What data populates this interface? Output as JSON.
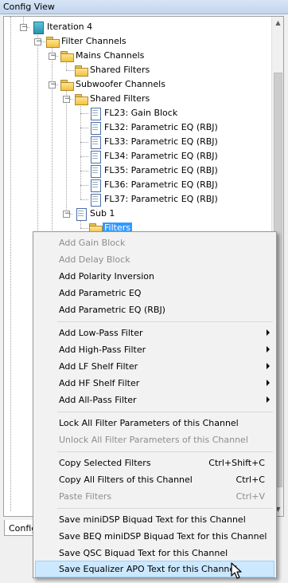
{
  "window": {
    "title": "Config View"
  },
  "tree": {
    "iteration": "Iteration 4",
    "filter_channels": "Filter Channels",
    "mains_channels": "Mains Channels",
    "mains_shared_filters": "Shared Filters",
    "subwoofer_channels": "Subwoofer Channels",
    "sub_shared_filters": "Shared Filters",
    "filters": [
      "FL23: Gain Block",
      "FL32: Parametric EQ (RBJ)",
      "FL33: Parametric EQ (RBJ)",
      "FL34: Parametric EQ (RBJ)",
      "FL35: Parametric EQ (RBJ)",
      "FL36: Parametric EQ (RBJ)",
      "FL37: Parametric EQ (RBJ)"
    ],
    "sub1": "Sub 1",
    "sub1_filters": "Filters"
  },
  "tab": {
    "label": "Config"
  },
  "menu": {
    "add_gain_block": "Add Gain Block",
    "add_delay_block": "Add Delay Block",
    "add_polarity_inversion": "Add Polarity Inversion",
    "add_parametric_eq": "Add Parametric EQ",
    "add_parametric_eq_rbj": "Add Parametric EQ (RBJ)",
    "add_low_pass": "Add Low-Pass Filter",
    "add_high_pass": "Add High-Pass Filter",
    "add_lf_shelf": "Add LF Shelf Filter",
    "add_hf_shelf": "Add HF Shelf Filter",
    "add_all_pass": "Add All-Pass Filter",
    "lock_all": "Lock All Filter Parameters of this Channel",
    "unlock_all": "Unlock All Filter Parameters of this Channel",
    "copy_selected": "Copy Selected Filters",
    "copy_selected_shortcut": "Ctrl+Shift+C",
    "copy_all": "Copy All Filters of this Channel",
    "copy_all_shortcut": "Ctrl+C",
    "paste": "Paste Filters",
    "paste_shortcut": "Ctrl+V",
    "save_minidsp": "Save miniDSP Biquad Text for this Channel",
    "save_beq": "Save BEQ miniDSP Biquad Text for this Channel",
    "save_qsc": "Save QSC Biquad Text for this Channel",
    "save_eq_apo": "Save Equalizer APO Text for this Channel"
  },
  "colors": {
    "selection": "#3399ff",
    "menu_highlight": "#cce8ff"
  },
  "icons": [
    "folder-icon",
    "document-icon",
    "iteration-icon",
    "submenu-arrow-icon",
    "mouse-cursor-icon"
  ]
}
